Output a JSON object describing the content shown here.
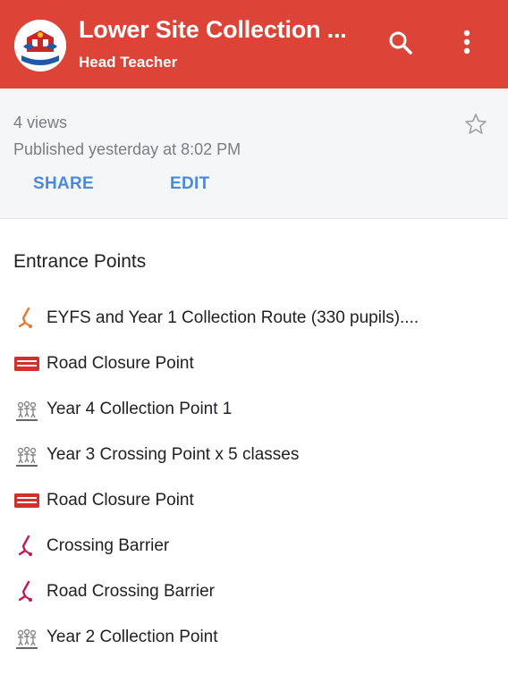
{
  "header": {
    "title": "Lower Site Collection ...",
    "subtitle": "Head Teacher",
    "logo_icon": "school-crest-icon",
    "search_icon": "search-icon",
    "menu_icon": "more-vert-icon",
    "background_color": "#db4437"
  },
  "info": {
    "views": "4 views",
    "published": "Published yesterday at 8:02 PM",
    "star_icon": "star-outline-icon",
    "share_label": "SHARE",
    "edit_label": "EDIT",
    "action_color": "#4a89dc"
  },
  "section": {
    "title": "Entrance Points",
    "items": [
      {
        "label": "EYFS and Year 1 Collection Route (330 pupils)....",
        "icon": "route-line-icon",
        "icon_color": "#e8772e"
      },
      {
        "label": "Road Closure Point",
        "icon": "road-closed-sign-icon",
        "icon_color": "#d32f2f"
      },
      {
        "label": "Year 4 Collection Point 1",
        "icon": "children-group-icon",
        "icon_color": "#888888"
      },
      {
        "label": "Year 3 Crossing Point x 5 classes",
        "icon": "children-group-icon",
        "icon_color": "#888888"
      },
      {
        "label": "Road Closure Point",
        "icon": "road-closed-sign-icon",
        "icon_color": "#d32f2f"
      },
      {
        "label": "Crossing Barrier",
        "icon": "route-line-icon",
        "icon_color": "#c2185b"
      },
      {
        "label": "Road Crossing Barrier",
        "icon": "route-line-icon",
        "icon_color": "#c2185b"
      },
      {
        "label": "Year 2 Collection Point",
        "icon": "children-group-icon",
        "icon_color": "#888888"
      }
    ]
  }
}
